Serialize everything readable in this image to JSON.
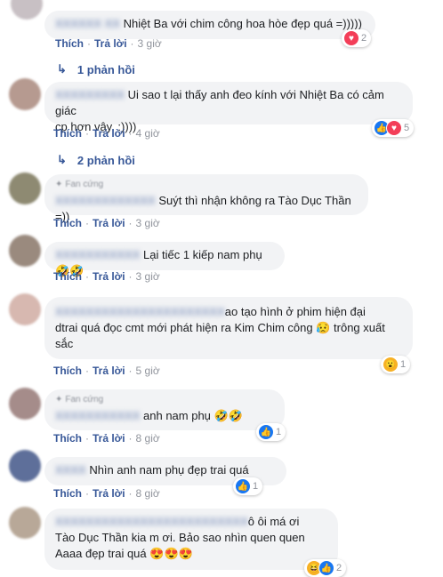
{
  "comments": [
    {
      "text": "Nhiệt Ba với chim công hoa hòe đẹp quá =)))))",
      "like": "Thích",
      "reply": "Trả lời",
      "time": "3 giờ",
      "reactions": "2",
      "replies": "1 phản hồi"
    },
    {
      "text": "Ui sao t lại thấy anh đeo kính với Nhiệt Ba có cảm giác",
      "text2": "cp hơn vậy. :))))",
      "like": "Thích",
      "reply": "Trả lời",
      "time": "4 giờ",
      "reactions": "5",
      "replies": "2 phản hồi"
    },
    {
      "badge": "Fan cứng",
      "text": "Suýt thì nhận không ra Tào Dục Thần =))",
      "like": "Thích",
      "reply": "Trả lời",
      "time": "3 giờ"
    },
    {
      "text": "Lại tiếc 1 kiếp nam phụ",
      "emoji": "🤣🤣",
      "like": "Thích",
      "reply": "Trả lời",
      "time": "3 giờ"
    },
    {
      "text": "ao tạo hình ở phim hiện đại",
      "text2": "dtrai quá đọc cmt mới phát hiện ra Kim Chim công",
      "emoji2": "😥",
      "text2b": "trông xuất",
      "text3": "sắc",
      "like": "Thích",
      "reply": "Trả lời",
      "time": "5 giờ",
      "reactions": "1"
    },
    {
      "badge": "Fan cứng",
      "text": "anh nam phụ",
      "emoji": "🤣🤣",
      "like": "Thích",
      "reply": "Trả lời",
      "time": "8 giờ",
      "reactions": "1"
    },
    {
      "text": "Nhìn anh nam phụ đẹp trai quá",
      "like": "Thích",
      "reply": "Trả lời",
      "time": "8 giờ",
      "reactions": "1"
    },
    {
      "text": "ô ôi má ơi",
      "text2": "Tào Dục Thần kia m ơi. Bảo sao nhìn quen quen",
      "text3": "Aaaa đẹp trai quá",
      "emoji3": "😍😍😍",
      "reactions": "2"
    }
  ],
  "icons": {
    "reply_arrow": "reply-arrow-icon",
    "colors": {
      "link": "#385898",
      "bubble": "#f2f3f5",
      "meta": "#90949c"
    }
  }
}
